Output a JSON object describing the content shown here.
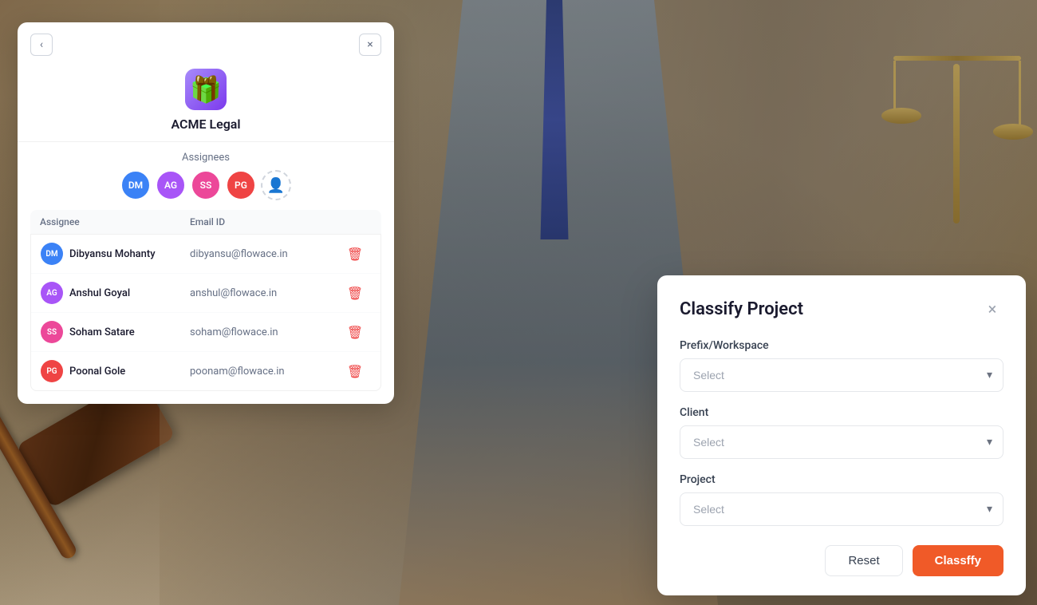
{
  "background": {
    "description": "Legal background with lawyer writing and gavel"
  },
  "assignees_panel": {
    "title": "ACME Legal",
    "section_label": "Assignees",
    "nav_back_label": "<",
    "close_label": "×",
    "add_assignee_label": "+",
    "columns": {
      "assignee": "Assignee",
      "email": "Email ID"
    },
    "avatars": [
      {
        "initials": "DM",
        "color": "#3b82f6",
        "name": "Dibyansu Mohanty"
      },
      {
        "initials": "AG",
        "color": "#a855f7",
        "name": "Anshul Goyal"
      },
      {
        "initials": "SS",
        "color": "#ec4899",
        "name": "Soham Satare"
      },
      {
        "initials": "PG",
        "color": "#ef4444",
        "name": "Poonal Gole"
      }
    ],
    "rows": [
      {
        "initials": "DM",
        "color": "#3b82f6",
        "name": "Dibyansu Mohanty",
        "email": "dibyansu@flowace.in"
      },
      {
        "initials": "AG",
        "color": "#a855f7",
        "name": "Anshul Goyal",
        "email": "anshul@flowace.in"
      },
      {
        "initials": "SS",
        "color": "#ec4899",
        "name": "Soham Satare",
        "email": "soham@flowace.in"
      },
      {
        "initials": "PG",
        "color": "#ef4444",
        "name": "Poonal Gole",
        "email": "poonam@flowace.in"
      }
    ]
  },
  "classify_modal": {
    "title": "Classify Project",
    "close_label": "×",
    "fields": [
      {
        "key": "prefix_workspace",
        "label": "Prefix/Workspace",
        "placeholder": "Select"
      },
      {
        "key": "client",
        "label": "Client",
        "placeholder": "Select"
      },
      {
        "key": "project",
        "label": "Project",
        "placeholder": "Select"
      }
    ],
    "buttons": {
      "reset": "Reset",
      "classify": "Classffy"
    }
  }
}
